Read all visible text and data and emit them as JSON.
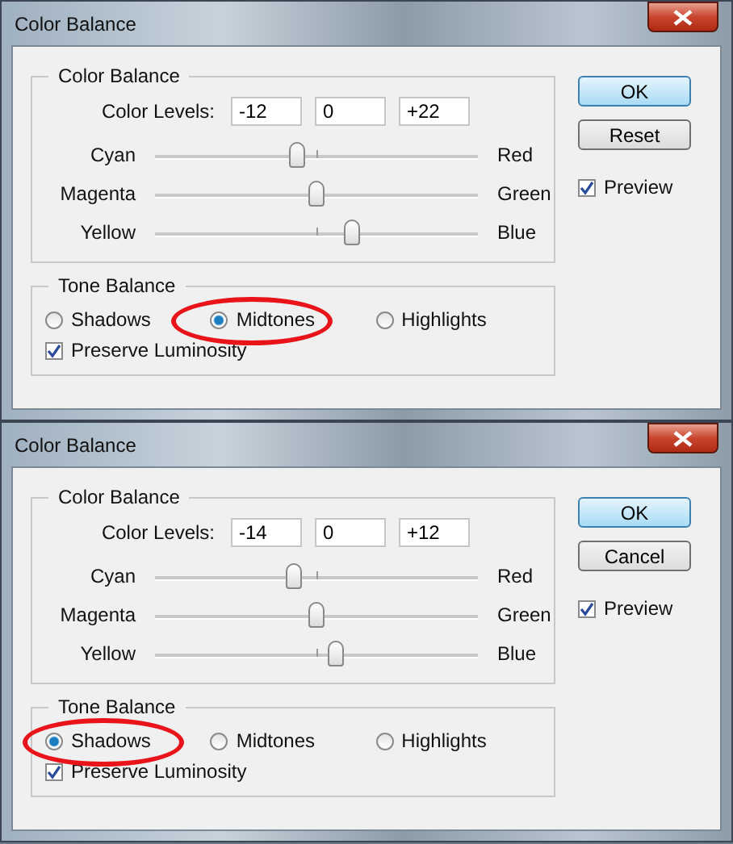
{
  "dialogs": [
    {
      "title": "Color Balance",
      "group_label": "Color Balance",
      "levels_label": "Color Levels:",
      "levels": [
        "-12",
        "0",
        "+22"
      ],
      "sliders": [
        {
          "left": "Cyan",
          "right": "Red",
          "level": 0.44
        },
        {
          "left": "Magenta",
          "right": "Green",
          "level": 0.5
        },
        {
          "left": "Yellow",
          "right": "Blue",
          "level": 0.61
        }
      ],
      "tone_label": "Tone Balance",
      "tones": [
        {
          "label": "Shadows",
          "selected": false
        },
        {
          "label": "Midtones",
          "selected": true
        },
        {
          "label": "Highlights",
          "selected": false
        }
      ],
      "preserve": {
        "label": "Preserve Luminosity",
        "checked": true
      },
      "buttons": [
        {
          "label": "OK",
          "kind": "default"
        },
        {
          "label": "Reset",
          "kind": "normal"
        }
      ],
      "preview": {
        "label": "Preview",
        "checked": true
      }
    },
    {
      "title": "Color Balance",
      "group_label": "Color Balance",
      "levels_label": "Color Levels:",
      "levels": [
        "-14",
        "0",
        "+12"
      ],
      "sliders": [
        {
          "left": "Cyan",
          "right": "Red",
          "level": 0.43
        },
        {
          "left": "Magenta",
          "right": "Green",
          "level": 0.5
        },
        {
          "left": "Yellow",
          "right": "Blue",
          "level": 0.56
        }
      ],
      "tone_label": "Tone Balance",
      "tones": [
        {
          "label": "Shadows",
          "selected": true
        },
        {
          "label": "Midtones",
          "selected": false
        },
        {
          "label": "Highlights",
          "selected": false
        }
      ],
      "preserve": {
        "label": "Preserve Luminosity",
        "checked": true
      },
      "buttons": [
        {
          "label": "OK",
          "kind": "default"
        },
        {
          "label": "Cancel",
          "kind": "normal"
        }
      ],
      "preview": {
        "label": "Preview",
        "checked": true
      }
    }
  ]
}
